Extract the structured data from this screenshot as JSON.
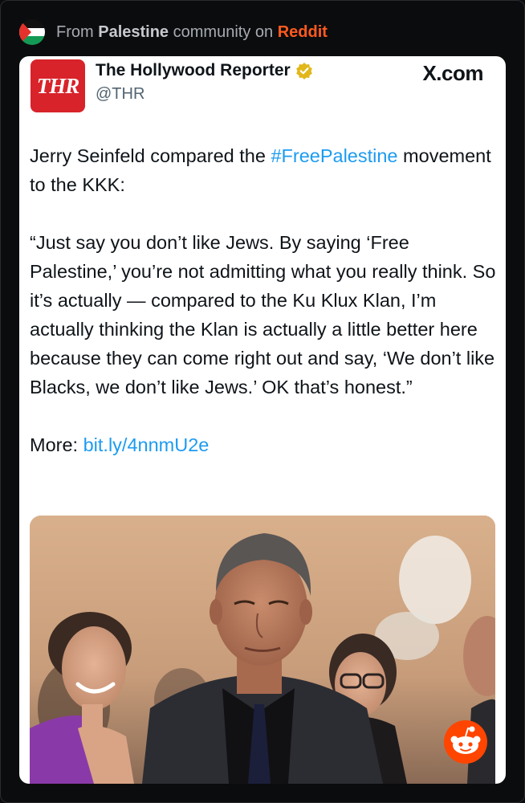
{
  "source_bar": {
    "prefix": "From",
    "community": "Palestine",
    "middle": "community on",
    "platform": "Reddit",
    "flag_icon": "palestine-flag-icon"
  },
  "post": {
    "author_name": "The Hollywood Reporter",
    "handle": "@THR",
    "logo_text": "THR",
    "site_label": "X.com",
    "verified_icon": "verified-badge-icon",
    "text_intro": "Jerry Seinfeld compared the ",
    "hashtag": "#FreePalestine",
    "text_intro_end": " movement to the KKK:",
    "quote": "“Just say you don’t like Jews. By saying ‘Free Palestine,’ you’re not admitting what you really think. So it’s actually — compared to the Ku Klux Klan, I’m actually thinking the Klan is actually a little better here because they can come right out and say, ‘We don’t like Blacks, we don’t like Jews.’ OK that’s honest.”",
    "more_label": "More: ",
    "more_link": "bit.ly/4nnmU2e"
  },
  "colors": {
    "background": "#0b0c0e",
    "card": "#ffffff",
    "link": "#1d9bf0",
    "reddit_orange": "#ff4500",
    "thr_red": "#d8232a"
  }
}
